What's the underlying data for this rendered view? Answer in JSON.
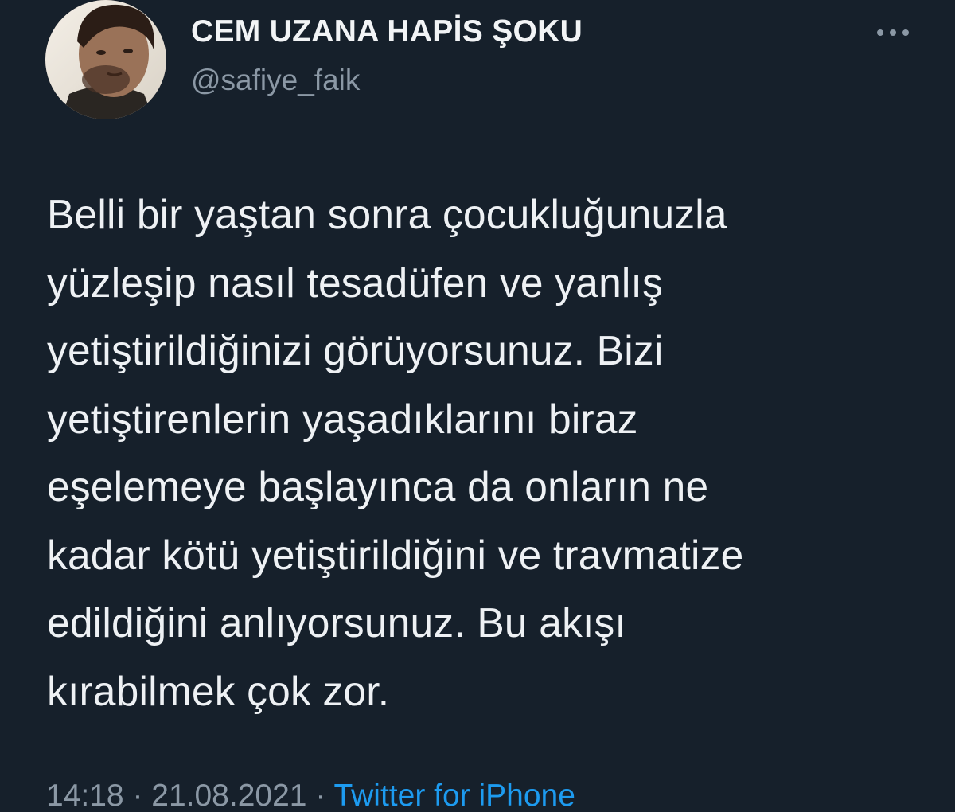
{
  "author": {
    "display_name": "CEM UZANA HAPİS ŞOKU",
    "handle": "@safiye_faik",
    "avatar_icon": "profile-photo"
  },
  "menu": {
    "icon": "more-options-icon"
  },
  "tweet": {
    "text": "Belli bir yaştan sonra çocukluğunuzla\nyüzleşip nasıl tesadüfen ve yanlış\nyetiştirildiğinizi görüyorsunuz. Bizi\nyetiştirenlerin yaşadıklarını biraz\neşelemeye başlayınca da onların ne\nkadar kötü yetiştirildiğini ve travmatize\nedildiğini anlıyorsunuz. Bu akışı\nkırabilmek çok zor.",
    "time": "14:18",
    "separator": " · ",
    "date": "21.08.2021",
    "source": "Twitter for iPhone"
  },
  "colors": {
    "background": "#16202b",
    "text": "#eef1f4",
    "secondary": "#8b98a5",
    "link": "#1d9bf0"
  }
}
